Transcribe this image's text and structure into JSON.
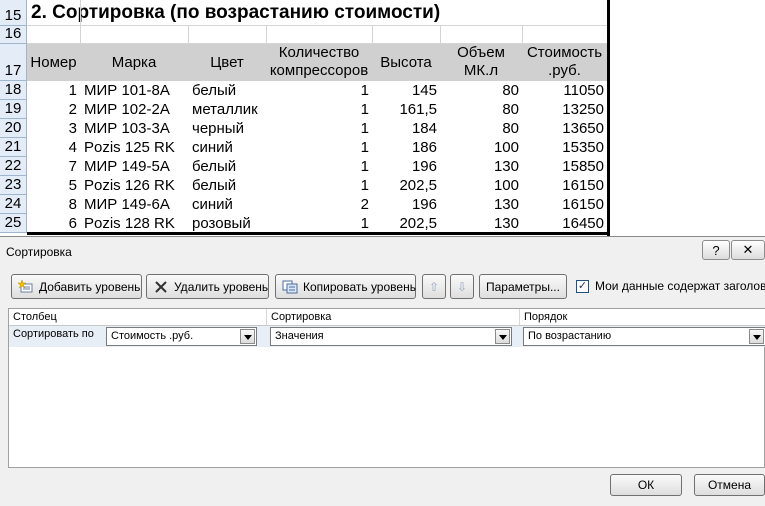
{
  "sheet": {
    "title": "2. Сортировка (по  возрастанию стоимости)",
    "row_numbers": [
      "15",
      "16",
      "17",
      "18",
      "19",
      "20",
      "21",
      "22",
      "23",
      "24",
      "25"
    ],
    "headers": {
      "nomer": "Номер",
      "marka": "Марка",
      "cvet": "Цвет",
      "kolvo_1": "Количество",
      "kolvo_2": "компрессоров",
      "vysota": "Высота",
      "obem_1": "Объем",
      "obem_2": "МК.л",
      "stoim_1": "Стоимость",
      "stoim_2": ".руб."
    },
    "rows": [
      {
        "n": "1",
        "marka": "МИР 101-8А",
        "cvet": "белый",
        "kol": "1",
        "vys": "145",
        "obem": "80",
        "st": "11050"
      },
      {
        "n": "2",
        "marka": "МИР 102-2А",
        "cvet": "металлик",
        "kol": "1",
        "vys": "161,5",
        "obem": "80",
        "st": "13250"
      },
      {
        "n": "3",
        "marka": "МИР 103-3А",
        "cvet": "черный",
        "kol": "1",
        "vys": "184",
        "obem": "80",
        "st": "13650"
      },
      {
        "n": "4",
        "marka": "Pozis 125 RK",
        "cvet": "синий",
        "kol": "1",
        "vys": "186",
        "obem": "100",
        "st": "15350"
      },
      {
        "n": "7",
        "marka": "МИР 149-5А",
        "cvet": "белый",
        "kol": "1",
        "vys": "196",
        "obem": "130",
        "st": "15850"
      },
      {
        "n": "5",
        "marka": "Pozis 126 RK",
        "cvet": "белый",
        "kol": "1",
        "vys": "202,5",
        "obem": "100",
        "st": "16150"
      },
      {
        "n": "8",
        "marka": "МИР 149-6А",
        "cvet": "синий",
        "kol": "2",
        "vys": "196",
        "obem": "130",
        "st": "16150"
      },
      {
        "n": "6",
        "marka": "Pozis 128 RK",
        "cvet": "розовый",
        "kol": "1",
        "vys": "202,5",
        "obem": "130",
        "st": "16450"
      }
    ]
  },
  "dialog": {
    "title": "Сортировка",
    "help_label": "?",
    "close_label": "✕",
    "toolbar": {
      "add_level": "Добавить уровень",
      "delete_level": "Удалить уровень",
      "copy_level": "Копировать уровень",
      "move_up": "⇧",
      "move_down": "⇩",
      "options": "Параметры...",
      "headers_checkbox_label": "Мои данные содержат заголовки",
      "headers_checkbox_mark": "✓"
    },
    "columns": {
      "col": "Столбец",
      "sort": "Сортировка",
      "order": "Порядок"
    },
    "sort_row": {
      "label": "Сортировать по",
      "column_value": "Стоимость .руб.",
      "sort_on_value": "Значения",
      "order_value": "По возрастанию"
    },
    "ok_label": "ОК",
    "cancel_label": "Отмена"
  },
  "colors": {
    "header_gray": "#d0d0d0",
    "row_header_blue": "#e4ecf7",
    "dialog_bg": "#f0f0f0",
    "selected_row": "#e8eef6"
  },
  "icons": [
    "add-level-icon",
    "delete-level-icon",
    "copy-level-icon",
    "arrow-up-icon",
    "arrow-down-icon",
    "checkbox-icon",
    "help-icon",
    "close-icon",
    "chevron-down-icon"
  ]
}
